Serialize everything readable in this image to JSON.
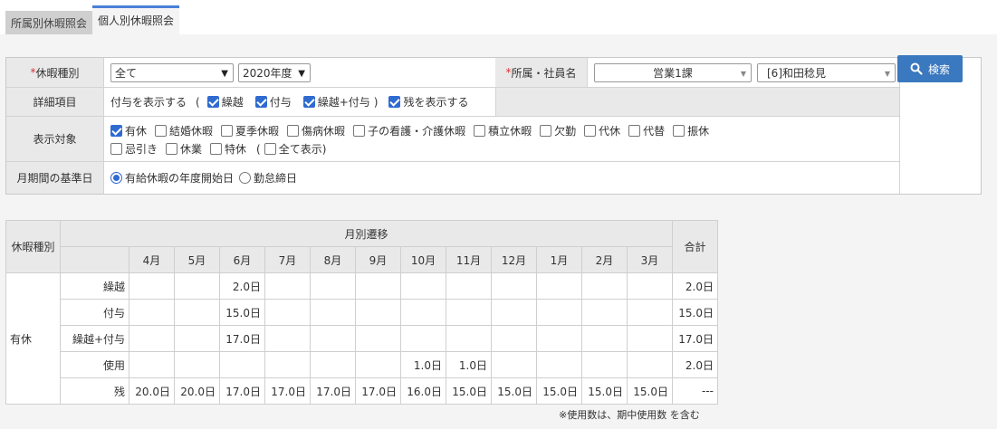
{
  "tabs": [
    {
      "label": "所属別休暇照会"
    },
    {
      "label": "個人別休暇照会"
    }
  ],
  "form": {
    "leave_type_label": "休暇種別",
    "leave_type_value": "全て",
    "year_value": "2020年度",
    "dept_emp_label": "所属・社員名",
    "dept_value": "営業1課",
    "employee_value": "[6]和田稔見",
    "detail_label": "詳細項目",
    "detail_prefix": "付与を表示する",
    "detail_paren_open": "(",
    "detail_paren_close": ")",
    "detail_items": [
      {
        "label": "繰越",
        "checked": true
      },
      {
        "label": "付与",
        "checked": true
      },
      {
        "label": "繰越+付与",
        "checked": true
      }
    ],
    "show_balance_label": "残を表示する",
    "target_label": "表示対象",
    "target_items": [
      {
        "label": "有休",
        "checked": true
      },
      {
        "label": "結婚休暇",
        "checked": false
      },
      {
        "label": "夏季休暇",
        "checked": false
      },
      {
        "label": "傷病休暇",
        "checked": false
      },
      {
        "label": "子の看護・介護休暇",
        "checked": false
      },
      {
        "label": "積立休暇",
        "checked": false
      },
      {
        "label": "欠勤",
        "checked": false
      },
      {
        "label": "代休",
        "checked": false
      },
      {
        "label": "代替",
        "checked": false
      },
      {
        "label": "振休",
        "checked": false
      }
    ],
    "target_items_row2": [
      {
        "label": "忌引き",
        "checked": false
      },
      {
        "label": "休業",
        "checked": false
      },
      {
        "label": "特休",
        "checked": false
      }
    ],
    "show_all_open": "(",
    "show_all_label": "全て表示)",
    "period_label": "月期間の基準日",
    "period_options": [
      {
        "label": "有給休暇の年度開始日",
        "selected": true
      },
      {
        "label": "勤怠締日",
        "selected": false
      }
    ],
    "search_label": "検索"
  },
  "table": {
    "col_leave_type": "休暇種別",
    "col_monthly": "月別遷移",
    "col_total": "合計",
    "months": [
      "4月",
      "5月",
      "6月",
      "7月",
      "8月",
      "9月",
      "10月",
      "11月",
      "12月",
      "1月",
      "2月",
      "3月"
    ],
    "leave_type": "有休",
    "rows": [
      {
        "label": "繰越",
        "values": [
          "",
          "",
          "2.0日",
          "",
          "",
          "",
          "",
          "",
          "",
          "",
          "",
          ""
        ],
        "total": "2.0日"
      },
      {
        "label": "付与",
        "values": [
          "",
          "",
          "15.0日",
          "",
          "",
          "",
          "",
          "",
          "",
          "",
          "",
          ""
        ],
        "total": "15.0日"
      },
      {
        "label": "繰越+付与",
        "values": [
          "",
          "",
          "17.0日",
          "",
          "",
          "",
          "",
          "",
          "",
          "",
          "",
          ""
        ],
        "total": "17.0日"
      },
      {
        "label": "使用",
        "values": [
          "",
          "",
          "",
          "",
          "",
          "",
          "1.0日",
          "1.0日",
          "",
          "",
          "",
          ""
        ],
        "total": "2.0日"
      },
      {
        "label": "残",
        "values": [
          "20.0日",
          "20.0日",
          "17.0日",
          "17.0日",
          "17.0日",
          "17.0日",
          "16.0日",
          "15.0日",
          "15.0日",
          "15.0日",
          "15.0日",
          "15.0日"
        ],
        "total": "---"
      }
    ]
  },
  "note": "※使用数は、期中使用数 を含む"
}
